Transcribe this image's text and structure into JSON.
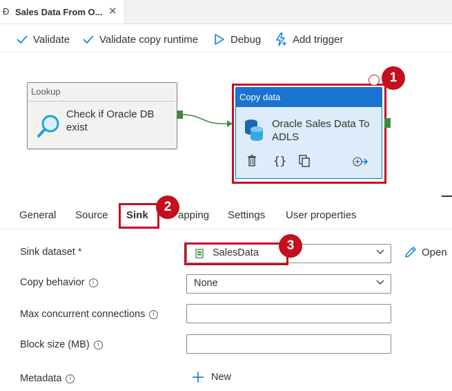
{
  "tab": {
    "title": "Sales Data From O...",
    "close_glyph": "✕"
  },
  "toolbar": {
    "validate": "Validate",
    "validate_runtime": "Validate copy runtime",
    "debug": "Debug",
    "add_trigger": "Add trigger"
  },
  "canvas": {
    "lookup": {
      "header": "Lookup",
      "title_line1": "Check if Oracle DB",
      "title_line2": "exist"
    },
    "copy": {
      "header": "Copy data",
      "title_line1": "Oracle Sales Data To",
      "title_line2": "ADLS",
      "code_glyph": "{}"
    }
  },
  "badges": {
    "one": "1",
    "two": "2",
    "three": "3"
  },
  "property_tabs": {
    "general": "General",
    "source": "Source",
    "sink": "Sink",
    "mapping": "apping",
    "settings": "Settings",
    "user_properties": "User properties"
  },
  "form": {
    "sink_dataset": {
      "label": "Sink dataset",
      "required_mark": "*",
      "value": "SalesData",
      "open": "Open"
    },
    "copy_behavior": {
      "label": "Copy behavior",
      "value": "None"
    },
    "max_conn": {
      "label": "Max concurrent connections",
      "value": ""
    },
    "block_size": {
      "label": "Block size (MB)",
      "value": ""
    },
    "metadata": {
      "label": "Metadata",
      "new": "New"
    },
    "info_glyph": "i"
  },
  "colors": {
    "accent": "#0078d4",
    "highlight": "#c50f1f",
    "connector": "#3f8a3f",
    "copy_header": "#1a73d0",
    "copy_body": "#dcecfa"
  }
}
